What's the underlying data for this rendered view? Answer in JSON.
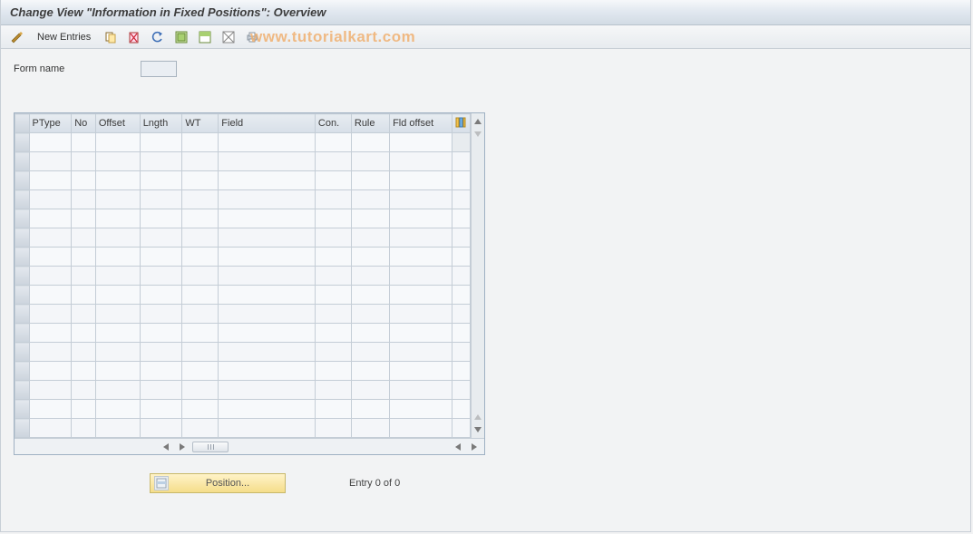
{
  "title": "Change View \"Information in Fixed Positions\": Overview",
  "toolbar": {
    "new_entries_label": "New Entries"
  },
  "watermark": "www.tutorialkart.com",
  "form": {
    "form_name_label": "Form name",
    "form_name_value": ""
  },
  "grid": {
    "columns": [
      "PType",
      "No",
      "Offset",
      "Lngth",
      "WT",
      "Field",
      "Con.",
      "Rule",
      "Fld offset"
    ],
    "row_count": 16
  },
  "footer": {
    "position_label": "Position...",
    "entry_text": "Entry 0 of 0"
  }
}
